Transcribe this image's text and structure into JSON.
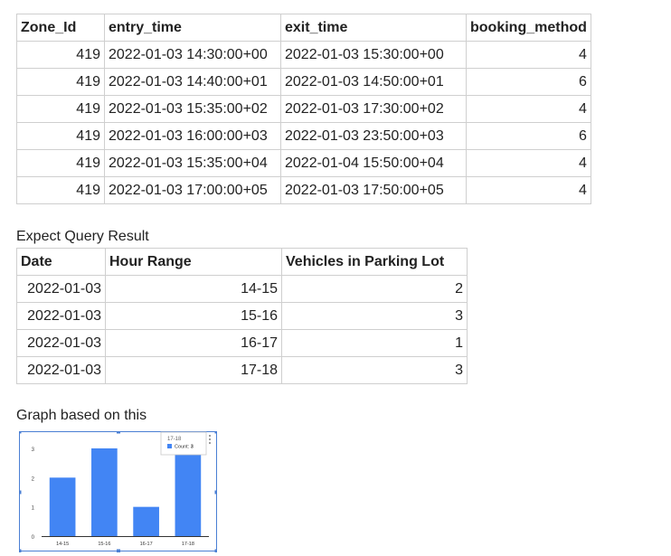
{
  "table1": {
    "headers": [
      "Zone_Id",
      "entry_time",
      "exit_time",
      "booking_method"
    ],
    "rows": [
      [
        "419",
        "2022-01-03 14:30:00+00",
        "2022-01-03 15:30:00+00",
        "4"
      ],
      [
        "419",
        "2022-01-03 14:40:00+01",
        "2022-01-03 14:50:00+01",
        "6"
      ],
      [
        "419",
        "2022-01-03 15:35:00+02",
        "2022-01-03 17:30:00+02",
        "4"
      ],
      [
        "419",
        "2022-01-03 16:00:00+03",
        "2022-01-03 23:50:00+03",
        "6"
      ],
      [
        "419",
        "2022-01-03 15:35:00+04",
        "2022-01-04 15:50:00+04",
        "4"
      ],
      [
        "419",
        "2022-01-03 17:00:00+05",
        "2022-01-03 17:50:00+05",
        "4"
      ]
    ]
  },
  "caption1": "Expect Query Result",
  "table2": {
    "headers": [
      "Date",
      "Hour Range",
      "Vehicles in Parking Lot"
    ],
    "rows": [
      [
        "2022-01-03",
        "14-15",
        "2"
      ],
      [
        "2022-01-03",
        "15-16",
        "3"
      ],
      [
        "2022-01-03",
        "16-17",
        "1"
      ],
      [
        "2022-01-03",
        "17-18",
        "3"
      ]
    ]
  },
  "caption2": "Graph based on this",
  "chart_data": {
    "type": "bar",
    "categories": [
      "14-15",
      "15-16",
      "16-17",
      "17-18"
    ],
    "values": [
      2,
      3,
      1,
      3
    ],
    "ylim": [
      0,
      3.4
    ],
    "yticks": [
      "0",
      "1",
      "2",
      "3"
    ],
    "grid": false,
    "bar_color": "#4285f4",
    "tooltip": {
      "title": "17-18",
      "label": "Count:",
      "value": "3"
    }
  },
  "colors": {
    "selection": "#4a7fd4",
    "border": "#cfcfcf"
  }
}
